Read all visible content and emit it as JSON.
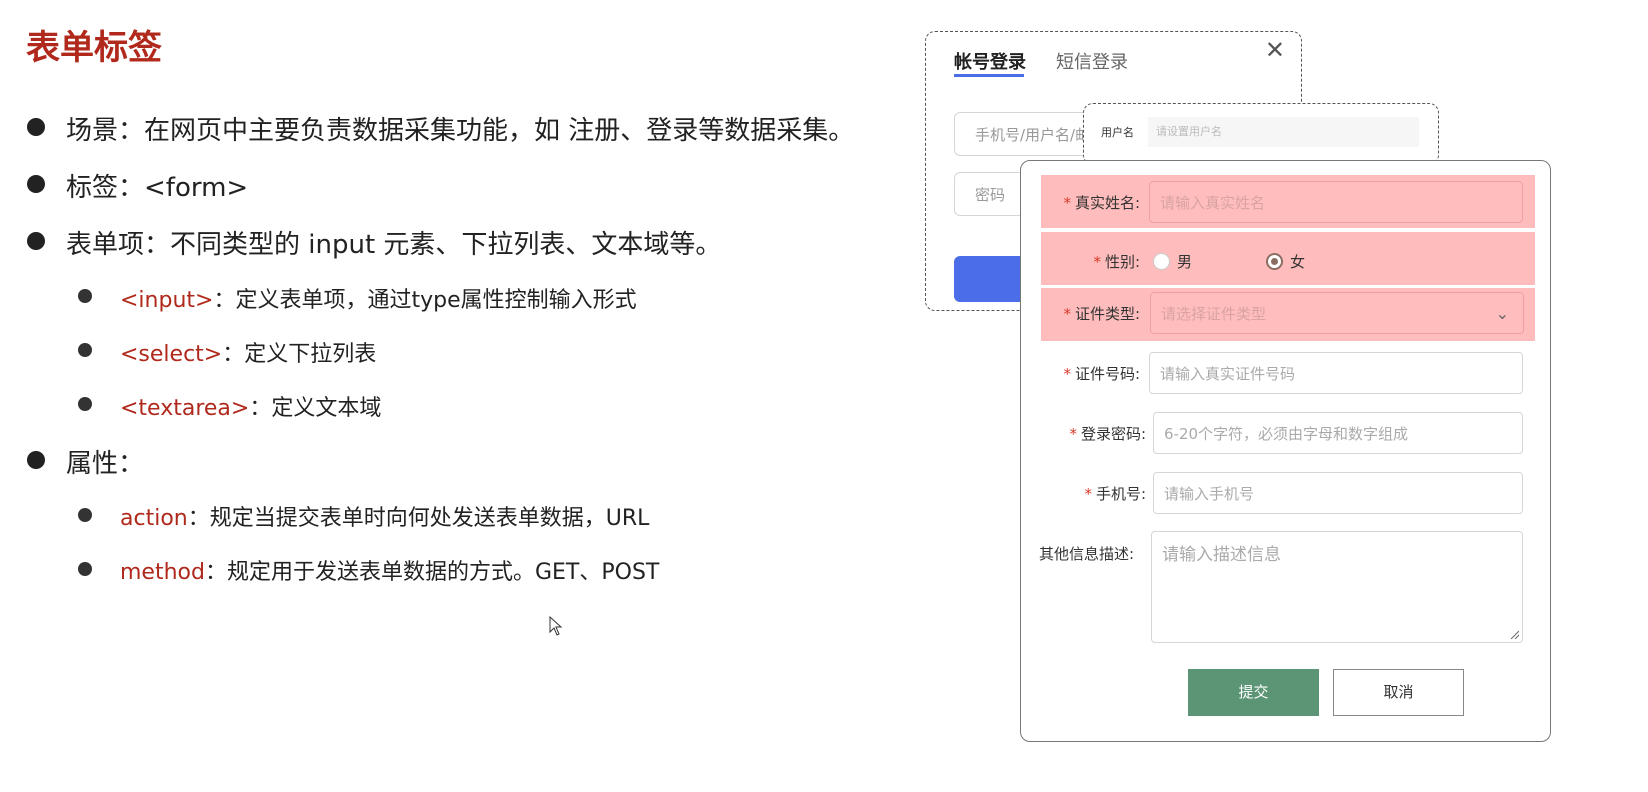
{
  "slide": {
    "title": "表单标签",
    "bullets": [
      {
        "text": "场景：在网页中主要负责数据采集功能，如 注册、登录等数据采集。"
      },
      {
        "text": "标签：<form>"
      },
      {
        "text": "表单项：不同类型的 input 元素、下拉列表、文本域等。"
      },
      {
        "kw": "<input>",
        "text": "：定义表单项，通过type属性控制输入形式"
      },
      {
        "kw": "<select>",
        "text": "：定义下拉列表"
      },
      {
        "kw": "<textarea>",
        "text": "：定义文本域"
      },
      {
        "text": "属性："
      },
      {
        "kw": "action",
        "text": "：规定当提交表单时向何处发送表单数据，URL"
      },
      {
        "kw": "method",
        "text": "：规定用于发送表单数据的方式。GET、POST"
      }
    ]
  },
  "login_dialog": {
    "tab_account": "帐号登录",
    "tab_sms": "短信登录",
    "close": "✕",
    "username_placeholder": "手机号/用户名/邮",
    "password_placeholder": "密码"
  },
  "register_snippet": {
    "label": "用户名",
    "placeholder": "请设置用户名"
  },
  "form": {
    "real_name": {
      "label": "真实姓名:",
      "placeholder": "请输入真实姓名"
    },
    "gender": {
      "label": "性别:",
      "male": "男",
      "female": "女",
      "selected": "女"
    },
    "id_type": {
      "label": "证件类型:",
      "placeholder": "请选择证件类型"
    },
    "id_number": {
      "label": "证件号码:",
      "placeholder": "请输入真实证件号码"
    },
    "password": {
      "label": "登录密码:",
      "placeholder": "6-20个字符，必须由字母和数字组成"
    },
    "phone": {
      "label": "手机号:",
      "placeholder": "请输入手机号"
    },
    "description": {
      "label": "其他信息描述:",
      "placeholder": "请输入描述信息"
    },
    "required_mark": "*",
    "submit": "提交",
    "cancel": "取消"
  },
  "colors": {
    "accent": "#b0291c",
    "highlight": "#ffbcbc",
    "submit": "#5c9575",
    "login_button": "#4b6ee8"
  }
}
